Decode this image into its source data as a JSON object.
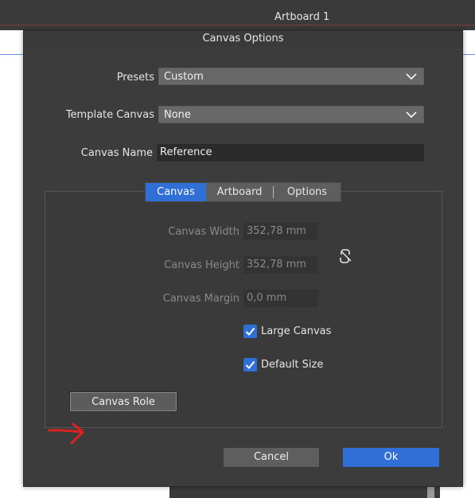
{
  "app": {
    "artboard_title": "Artboard 1"
  },
  "dialog": {
    "title": "Canvas Options",
    "presets": {
      "label": "Presets",
      "value": "Custom"
    },
    "template_canvas": {
      "label": "Template Canvas",
      "value": "None"
    },
    "canvas_name": {
      "label": "Canvas Name",
      "value": "Reference"
    },
    "tabs": [
      {
        "label": "Canvas",
        "active": true
      },
      {
        "label": "Artboard",
        "active": false
      },
      {
        "label": "Options",
        "active": false
      }
    ],
    "fields": {
      "width": {
        "label": "Canvas Width",
        "value": "352,78 mm"
      },
      "height": {
        "label": "Canvas Height",
        "value": "352,78 mm"
      },
      "margin": {
        "label": "Canvas Margin",
        "value": "0,0 mm"
      }
    },
    "checkboxes": {
      "large_canvas": {
        "label": "Large Canvas",
        "checked": true
      },
      "default_size": {
        "label": "Default Size",
        "checked": true
      }
    },
    "canvas_role_button": "Canvas Role",
    "cancel_button": "Cancel",
    "ok_button": "Ok"
  },
  "colors": {
    "accent": "#2f6fd6",
    "annotation_arrow": "#e02020"
  },
  "icons": {
    "link": "unlink-chain-icon",
    "dropdown": "chevron-down-icon",
    "check": "checkmark-icon"
  }
}
